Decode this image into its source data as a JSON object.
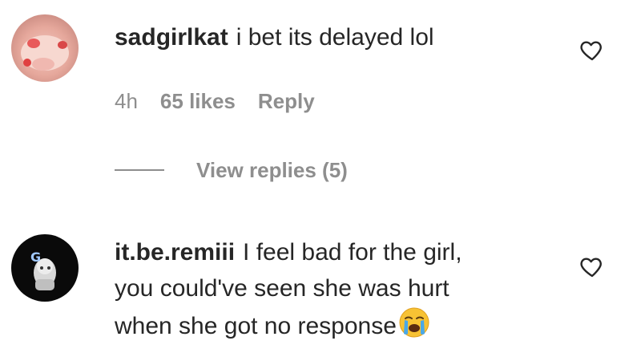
{
  "comments": [
    {
      "username": "sadgirlkat",
      "text": "i bet its delayed lol",
      "time": "4h",
      "likes": "65 likes",
      "reply_label": "Reply"
    },
    {
      "username": "it.be.remiii",
      "text": "I feel bad for the girl,\nyou could've seen she was hurt\nwhen she got no response",
      "emoji": "crying-face"
    }
  ],
  "view_replies_label": "View replies (5)",
  "icons": {
    "like": "heart-outline-icon"
  },
  "colors": {
    "text": "#262626",
    "secondary": "#8e8e8e"
  }
}
